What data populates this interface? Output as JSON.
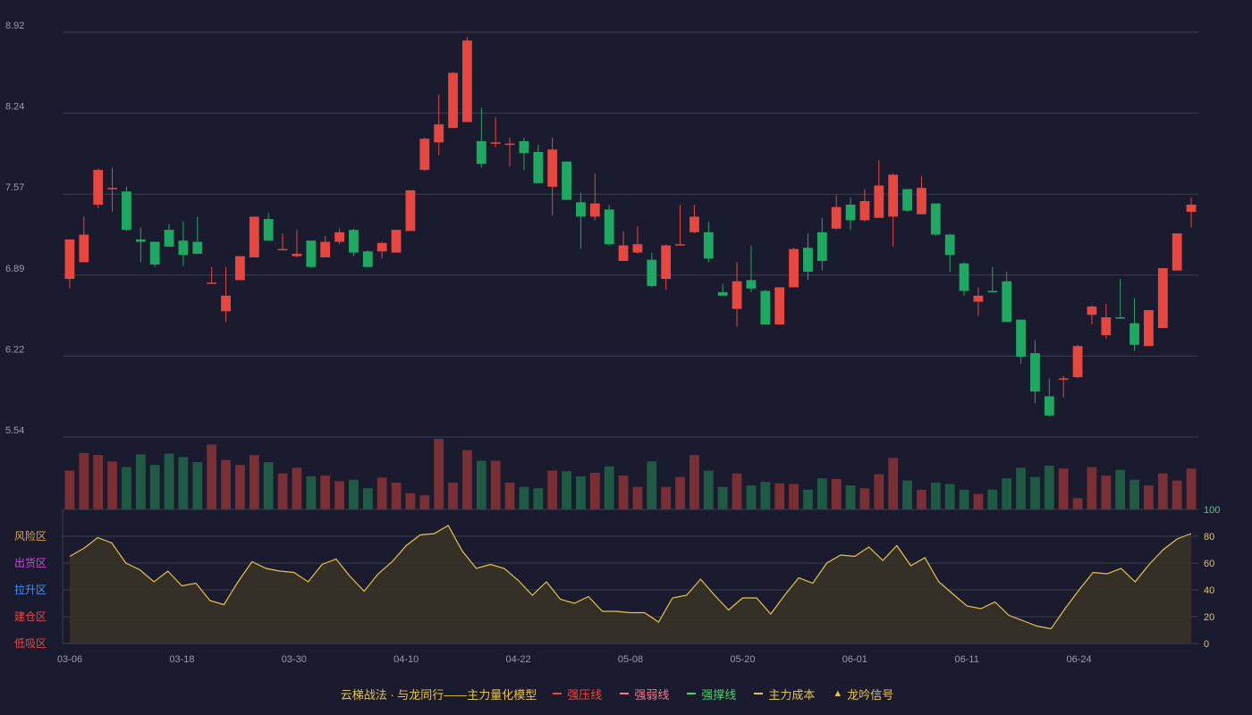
{
  "colors": {
    "background": "#1a1b2e",
    "up": "#e8473f",
    "down": "#1fa862",
    "up_volume": "#7a2f35",
    "down_volume": "#1f5a45",
    "grid": "#3a3c52",
    "axis_text": "#9a9cae",
    "indicator_line": "#e8c34a",
    "indicator_fill": "#3a3426",
    "indicator_axis_text": "#e8c34a",
    "indicator_axis_top": "#4cd26b"
  },
  "zones": [
    {
      "label": "风险区",
      "color": "#e8a23a"
    },
    {
      "label": "出货区",
      "color": "#d04ad8"
    },
    {
      "label": "拉升区",
      "color": "#4a8ef0"
    },
    {
      "label": "建仓区",
      "color": "#e8473f"
    },
    {
      "label": "低吸区",
      "color": "#e8473f"
    }
  ],
  "legend": {
    "title": "云梯战法 · 与龙同行——主力量化模型",
    "items": [
      {
        "label": "强压线",
        "color": "#e8473f",
        "style": "solid",
        "icon": "solid-line-icon"
      },
      {
        "label": "强弱线",
        "color": "#f27a8a",
        "style": "dash",
        "icon": "dashed-line-icon"
      },
      {
        "label": "强撑线",
        "color": "#4cd26b",
        "style": "solid",
        "icon": "solid-line-icon"
      },
      {
        "label": "主力成本",
        "color": "#e8c34a",
        "style": "dash",
        "icon": "dashed-line-icon"
      },
      {
        "label": "龙吟信号",
        "color": "#e8c34a",
        "style": "triangle",
        "icon": "triangle-icon"
      }
    ]
  },
  "chart_data": [
    {
      "type": "candlestick",
      "y_ticks": [
        "8.92",
        "8.24",
        "7.57",
        "6.89",
        "6.22",
        "5.54"
      ],
      "ylim": [
        5.54,
        8.92
      ],
      "x_tick_labels": [
        {
          "index": 0,
          "label": "03-06"
        },
        {
          "index": 8,
          "label": "03-18"
        },
        {
          "index": 16,
          "label": "03-30"
        },
        {
          "index": 24,
          "label": "04-10"
        },
        {
          "index": 32,
          "label": "04-22"
        },
        {
          "index": 40,
          "label": "05-08"
        },
        {
          "index": 48,
          "label": "05-20"
        },
        {
          "index": 56,
          "label": "06-01"
        },
        {
          "index": 64,
          "label": "06-11"
        },
        {
          "index": 72,
          "label": "06-24"
        }
      ],
      "ohlc": [
        [
          6.86,
          7.19,
          6.78,
          7.19
        ],
        [
          7.0,
          7.38,
          7.0,
          7.23
        ],
        [
          7.48,
          7.78,
          7.45,
          7.77
        ],
        [
          7.62,
          7.79,
          7.42,
          7.62
        ],
        [
          7.59,
          7.63,
          7.26,
          7.27
        ],
        [
          7.19,
          7.29,
          7.0,
          7.17
        ],
        [
          7.17,
          7.17,
          6.96,
          6.98
        ],
        [
          7.27,
          7.32,
          7.13,
          7.13
        ],
        [
          7.18,
          7.34,
          6.97,
          7.06
        ],
        [
          7.17,
          7.38,
          7.07,
          7.07
        ],
        [
          6.83,
          6.96,
          6.82,
          6.83
        ],
        [
          6.59,
          6.96,
          6.5,
          6.72
        ],
        [
          6.85,
          7.05,
          6.85,
          7.05
        ],
        [
          7.04,
          7.35,
          7.04,
          7.38
        ],
        [
          7.36,
          7.41,
          7.18,
          7.18
        ],
        [
          7.11,
          7.24,
          7.1,
          7.11
        ],
        [
          7.05,
          7.27,
          7.04,
          7.07
        ],
        [
          7.18,
          7.18,
          6.95,
          6.96
        ],
        [
          7.04,
          7.22,
          7.04,
          7.17
        ],
        [
          7.17,
          7.28,
          7.15,
          7.25
        ],
        [
          7.27,
          7.28,
          7.05,
          7.08
        ],
        [
          7.09,
          7.1,
          6.96,
          6.96
        ],
        [
          7.09,
          7.17,
          7.03,
          7.16
        ],
        [
          7.08,
          7.25,
          7.08,
          7.27
        ],
        [
          7.26,
          7.59,
          7.26,
          7.6
        ],
        [
          7.77,
          8.04,
          7.76,
          8.03
        ],
        [
          8.0,
          8.4,
          7.89,
          8.15
        ],
        [
          8.12,
          8.59,
          8.12,
          8.58
        ],
        [
          8.17,
          8.88,
          8.17,
          8.85
        ],
        [
          8.01,
          8.29,
          7.79,
          7.82
        ],
        [
          7.99,
          8.21,
          7.96,
          8.0
        ],
        [
          7.99,
          8.04,
          7.8,
          7.99
        ],
        [
          8.01,
          8.04,
          7.77,
          7.91
        ],
        [
          7.92,
          7.98,
          7.67,
          7.66
        ],
        [
          7.63,
          8.04,
          7.39,
          7.94
        ],
        [
          7.84,
          7.84,
          7.52,
          7.52
        ],
        [
          7.5,
          7.58,
          7.11,
          7.38
        ],
        [
          7.38,
          7.74,
          7.35,
          7.49
        ],
        [
          7.44,
          7.48,
          7.14,
          7.15
        ],
        [
          7.01,
          7.26,
          7.01,
          7.14
        ],
        [
          7.08,
          7.3,
          7.07,
          7.15
        ],
        [
          7.02,
          7.08,
          6.79,
          6.8
        ],
        [
          6.86,
          7.15,
          6.77,
          7.14
        ],
        [
          7.14,
          7.48,
          7.14,
          7.15
        ],
        [
          7.25,
          7.48,
          7.24,
          7.38
        ],
        [
          7.25,
          7.34,
          7.0,
          7.03
        ],
        [
          6.75,
          6.82,
          6.75,
          6.72
        ],
        [
          6.61,
          7.0,
          6.46,
          6.84
        ],
        [
          6.85,
          7.14,
          6.75,
          6.78
        ],
        [
          6.76,
          6.77,
          6.48,
          6.48
        ],
        [
          6.48,
          6.79,
          6.48,
          6.79
        ],
        [
          6.79,
          7.12,
          6.79,
          7.11
        ],
        [
          7.12,
          7.24,
          6.85,
          6.92
        ],
        [
          7.25,
          7.37,
          6.93,
          7.01
        ],
        [
          7.28,
          7.56,
          7.27,
          7.46
        ],
        [
          7.48,
          7.54,
          7.27,
          7.35
        ],
        [
          7.35,
          7.61,
          7.34,
          7.51
        ],
        [
          7.37,
          7.85,
          7.37,
          7.64
        ],
        [
          7.38,
          7.74,
          7.13,
          7.73
        ],
        [
          7.61,
          7.61,
          7.42,
          7.43
        ],
        [
          7.4,
          7.72,
          7.4,
          7.62
        ],
        [
          7.49,
          7.49,
          7.22,
          7.23
        ],
        [
          7.23,
          7.24,
          6.92,
          7.06
        ],
        [
          6.99,
          7.0,
          6.72,
          6.76
        ],
        [
          6.67,
          6.79,
          6.55,
          6.72
        ],
        [
          6.76,
          6.96,
          6.76,
          6.75
        ],
        [
          6.84,
          6.92,
          6.5,
          6.5
        ],
        [
          6.52,
          6.52,
          6.15,
          6.21
        ],
        [
          6.24,
          6.35,
          5.82,
          5.92
        ],
        [
          5.88,
          6.03,
          5.71,
          5.72
        ],
        [
          6.02,
          6.05,
          5.87,
          6.03
        ],
        [
          6.04,
          6.31,
          6.03,
          6.3
        ],
        [
          6.56,
          6.64,
          6.48,
          6.63
        ],
        [
          6.39,
          6.65,
          6.36,
          6.54
        ],
        [
          6.54,
          6.86,
          6.53,
          6.53
        ],
        [
          6.49,
          6.7,
          6.26,
          6.31
        ],
        [
          6.3,
          6.6,
          6.3,
          6.6
        ],
        [
          6.45,
          6.95,
          6.45,
          6.95
        ],
        [
          6.93,
          7.24,
          6.95,
          7.24
        ],
        [
          7.42,
          7.54,
          7.29,
          7.48
        ]
      ],
      "volume": [
        0.55,
        0.8,
        0.77,
        0.68,
        0.6,
        0.78,
        0.63,
        0.79,
        0.74,
        0.67,
        0.92,
        0.7,
        0.63,
        0.77,
        0.67,
        0.51,
        0.59,
        0.47,
        0.48,
        0.4,
        0.42,
        0.3,
        0.45,
        0.38,
        0.23,
        0.2,
        1.0,
        0.38,
        0.84,
        0.69,
        0.69,
        0.38,
        0.32,
        0.3,
        0.55,
        0.54,
        0.47,
        0.52,
        0.61,
        0.48,
        0.32,
        0.68,
        0.32,
        0.46,
        0.77,
        0.55,
        0.32,
        0.51,
        0.34,
        0.39,
        0.37,
        0.36,
        0.28,
        0.44,
        0.43,
        0.34,
        0.3,
        0.5,
        0.73,
        0.41,
        0.28,
        0.38,
        0.36,
        0.28,
        0.22,
        0.28,
        0.44,
        0.59,
        0.46,
        0.62,
        0.58,
        0.16,
        0.6,
        0.48,
        0.56,
        0.42,
        0.34,
        0.51,
        0.41,
        0.58
      ]
    },
    {
      "type": "area",
      "y_ticks": [
        "100",
        "80",
        "60",
        "40",
        "20",
        "0"
      ],
      "ylim": [
        0,
        100
      ],
      "values": [
        65,
        71,
        79,
        75,
        60,
        55,
        46,
        54,
        43,
        45,
        32,
        29,
        46,
        61,
        56,
        54,
        53,
        46,
        59,
        63,
        50,
        39,
        52,
        61,
        73,
        81,
        82,
        88,
        69,
        56,
        59,
        56,
        47,
        36,
        46,
        33,
        30,
        35,
        24,
        24,
        23,
        23,
        16,
        34,
        36,
        48,
        36,
        25,
        34,
        34,
        22,
        36,
        49,
        45,
        60,
        66,
        65,
        72,
        62,
        73,
        58,
        64,
        46,
        37,
        28,
        26,
        31,
        21,
        17,
        13,
        11,
        26,
        40,
        53,
        52,
        56,
        46,
        59,
        70,
        78,
        82
      ]
    }
  ]
}
